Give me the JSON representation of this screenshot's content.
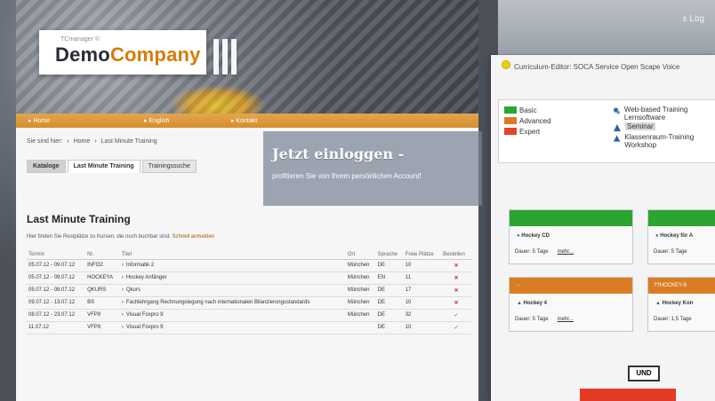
{
  "top_tag": "ε Log",
  "site": {
    "logo_small": "TCmanager ©",
    "logo_main_prefix": "Demo",
    "logo_main_suffix": "Company",
    "nav": [
      "Home",
      "English",
      "Kontakt"
    ],
    "breadcrumb": {
      "lead": "Sie sind hier:",
      "items": [
        "Home",
        "Last Minute Training"
      ]
    },
    "tabs": [
      "Kataloge",
      "Last Minute Training",
      "Trainingssuche"
    ],
    "overlay": {
      "title": "Jetzt einloggen -",
      "text": "profitieren Sie von Ihrem persönlichen Account!"
    },
    "page_title": "Last Minute Training",
    "intro_text": "Hier finden Sie Restplätze zu Kursen, die noch buchbar sind.",
    "intro_link": "Schnell anmelden",
    "table": {
      "headers": [
        "Termin",
        "Nr.",
        "Titel",
        "Ort",
        "Sprache",
        "Freie Plätze",
        "Bestellen"
      ],
      "rows": [
        {
          "termin": "05.07.12 - 09.07.12",
          "nr": "INFO2",
          "titel": "Informatik 2",
          "ort": "München",
          "sprache": "DE",
          "plaetze": "10",
          "status": "full"
        },
        {
          "termin": "05.07.12 - 09.07.12",
          "nr": "HOCKEYA",
          "titel": "Hockey Anfänger",
          "ort": "München",
          "sprache": "EN",
          "plaetze": "11",
          "status": "full"
        },
        {
          "termin": "05.07.12 - 08.07.12",
          "nr": "QKURS",
          "titel": "Qkurs",
          "ort": "München",
          "sprache": "DE",
          "plaetze": "17",
          "status": "full"
        },
        {
          "termin": "09.07.12 - 13.07.12",
          "nr": "BS",
          "titel": "Fachlehrgang Rechnungslegung nach internationalen Bilanzierungsstandards",
          "ort": "München",
          "sprache": "DE",
          "plaetze": "10",
          "status": "full"
        },
        {
          "termin": "08.07.12 - 23.07.12",
          "nr": "VFP9",
          "titel": "Visual Foxpro 9",
          "ort": "München",
          "sprache": "DE",
          "plaetze": "32",
          "status": "ok"
        },
        {
          "termin": "11.07.12",
          "nr": "VFP9",
          "titel": "Visual Foxpro 9",
          "ort": "",
          "sprache": "DE",
          "plaetze": "10",
          "status": "ok"
        }
      ]
    }
  },
  "panel": {
    "title": "Curriculum-Editor: SOCA Service Open Scape Voice",
    "legend_levels": [
      {
        "label": "Basic",
        "color": "#2aa52f"
      },
      {
        "label": "Advanced",
        "color": "#d97d24"
      },
      {
        "label": "Expert",
        "color": "#e54428"
      }
    ],
    "legend_types": [
      {
        "label": "Web-based Training Lernsoftware",
        "icon": "wbt-icon"
      },
      {
        "label": "Seminar",
        "icon": "seminar-icon",
        "highlight": true
      },
      {
        "label": "Klassenraum-Training Workshop",
        "icon": "classroom-icon"
      }
    ],
    "nodes": [
      {
        "title": "Hockey CD",
        "duration": "Dauer: 5 Tage",
        "more": "mehr...",
        "color": "#2aa52f"
      },
      {
        "title": "Hockey für A",
        "duration": "Dauer: 5 Tage",
        "more": "",
        "color": "#2aa52f"
      },
      {
        "title": "Hockey 4",
        "duration": "Dauer: 5 Tage",
        "more": "mehr...",
        "color": "#d97d24",
        "code": "···"
      },
      {
        "title": "Hockey Kon",
        "duration": "Dauer: 1,5 Tage",
        "more": "",
        "color": "#d97d24",
        "code": "??HOCKEY-9"
      }
    ],
    "und_label": "UND"
  }
}
